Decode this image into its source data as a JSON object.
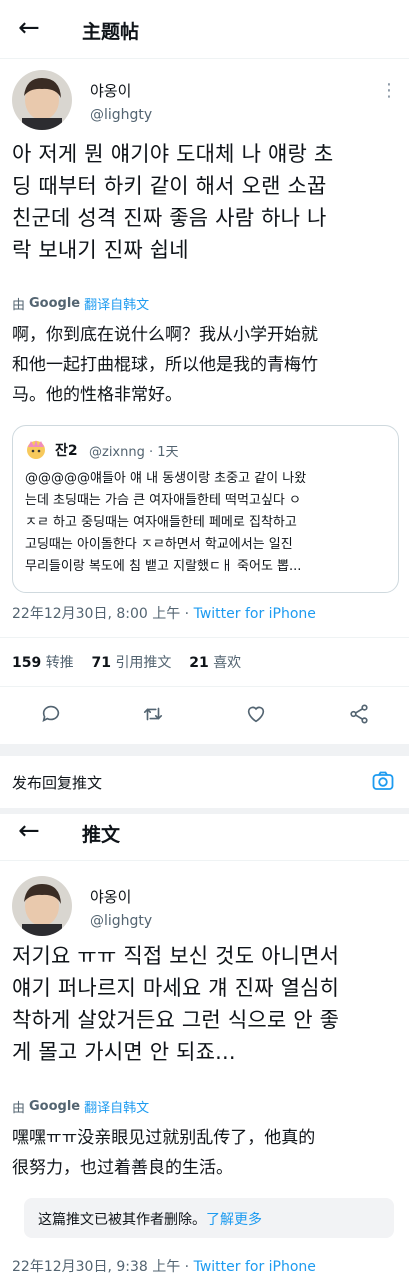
{
  "header": {
    "title": "主题帖"
  },
  "tweet1": {
    "author_name": "야옹이",
    "author_handle": "@lighgty",
    "text_lines": [
      "아 저게 뭔 얘기야 도대체 나 얘랑 초",
      "딩 때부터 하키 같이 해서 오랜 소꿉",
      "친군데 성격 진짜 좋음 사람 하나 나",
      "락 보내기 진짜 쉽네"
    ],
    "translate_by": "由",
    "translate_google": "Google",
    "translate_link": "翻译自韩文",
    "translation_lines": [
      "啊，你到底在说什么啊？我从小学开始就",
      "和他一起打曲棍球，所以他是我的青梅竹",
      "马。他的性格非常好。"
    ],
    "quote": {
      "name": "잔2",
      "handle": "@zixnng",
      "time": "· 1天",
      "text_lines": [
        "@@@@@얘들아 얘 내 동생이랑 초중고 같이 나왔",
        "는데 초딩때는 가슴 큰 여자애들한테 떡먹고싶다 ㅇ",
        "ㅈㄹ 하고 중딩때는 여자애들한테 페메로 집착하고",
        "고딩때는 아이돌한다 ㅈㄹ하면서 학교에서는 일진",
        "무리들이랑 복도에 침 뱉고 지랄했ㄷㅐ 죽어도 뽑..."
      ]
    },
    "meta_date": "22年12月30日, 8:00 上午 ·",
    "meta_via": "Twitter for iPhone",
    "stats": {
      "retweets": "159",
      "retweets_label": "转推",
      "quotes": "71",
      "quotes_label": "引用推文",
      "likes": "21",
      "likes_label": "喜欢"
    }
  },
  "reply_prompt": "发布回复推文",
  "header2": {
    "title": "推文"
  },
  "tweet2": {
    "author_name": "야옹이",
    "author_handle": "@lighgty",
    "text_lines": [
      "저기요 ㅠㅠ 직접 보신 것도 아니면서",
      "얘기 퍼나르지 마세요 걔 진짜 열심히",
      "착하게 살았거든요 그런 식으로 안 좋",
      "게 몰고 가시면 안 되죠..."
    ],
    "translate_by": "由",
    "translate_google": "Google",
    "translate_link": "翻译自韩文",
    "translation_lines": [
      "嘿嘿ㅠㅠ没亲眼见过就别乱传了，他真的",
      "很努力，也过着善良的生活。"
    ],
    "deleted_notice": "这篇推文已被其作者删除。",
    "deleted_link": "了解更多",
    "meta_date": "22年12月30日, 9:38 上午 ·",
    "meta_via": "Twitter for iPhone"
  },
  "colors": {
    "link": "#1d9bf0",
    "muted": "#536471",
    "text": "#0f1419"
  },
  "icons": [
    "back-arrow-icon",
    "more-icon",
    "reply-icon",
    "retweet-icon",
    "like-icon",
    "share-icon",
    "camera-icon"
  ]
}
